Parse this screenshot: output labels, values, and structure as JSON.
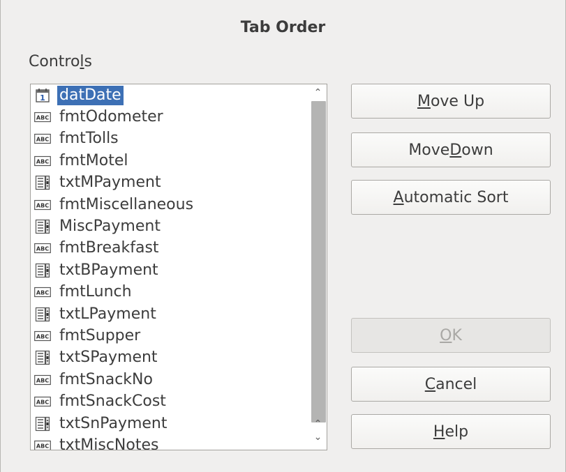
{
  "dialog": {
    "title": "Tab Order"
  },
  "controls_label": {
    "pre": "Contro",
    "mnemonic": "l",
    "post": "s"
  },
  "controls": [
    {
      "icon": "date-field-icon",
      "label": "datDate",
      "selected": true
    },
    {
      "icon": "formatted-field-icon",
      "label": "fmtOdometer"
    },
    {
      "icon": "formatted-field-icon",
      "label": "fmtTolls"
    },
    {
      "icon": "formatted-field-icon",
      "label": "fmtMotel"
    },
    {
      "icon": "text-box-icon",
      "label": "txtMPayment"
    },
    {
      "icon": "formatted-field-icon",
      "label": "fmtMiscellaneous"
    },
    {
      "icon": "text-box-icon",
      "label": "MiscPayment"
    },
    {
      "icon": "formatted-field-icon",
      "label": "fmtBreakfast"
    },
    {
      "icon": "text-box-icon",
      "label": "txtBPayment"
    },
    {
      "icon": "formatted-field-icon",
      "label": "fmtLunch"
    },
    {
      "icon": "text-box-icon",
      "label": "txtLPayment"
    },
    {
      "icon": "formatted-field-icon",
      "label": "fmtSupper"
    },
    {
      "icon": "text-box-icon",
      "label": "txtSPayment"
    },
    {
      "icon": "formatted-field-icon",
      "label": "fmtSnackNo"
    },
    {
      "icon": "formatted-field-icon",
      "label": "fmtSnackCost"
    },
    {
      "icon": "text-box-icon",
      "label": "txtSnPayment"
    },
    {
      "icon": "formatted-field-icon",
      "label": "txtMiscNotes"
    }
  ],
  "buttons": {
    "move_up": {
      "mnemonic": "M",
      "rest": "ove Up"
    },
    "move_down": {
      "pre": "Move ",
      "mnemonic": "D",
      "rest": "own"
    },
    "auto_sort": {
      "mnemonic": "A",
      "rest": "utomatic Sort"
    },
    "ok": {
      "mnemonic": "O",
      "rest": "K"
    },
    "cancel": {
      "mnemonic": "C",
      "rest": "ancel"
    },
    "help": {
      "mnemonic": "H",
      "rest": "elp"
    }
  },
  "colors": {
    "selection": "#3d70b5",
    "background": "#f0efee"
  }
}
